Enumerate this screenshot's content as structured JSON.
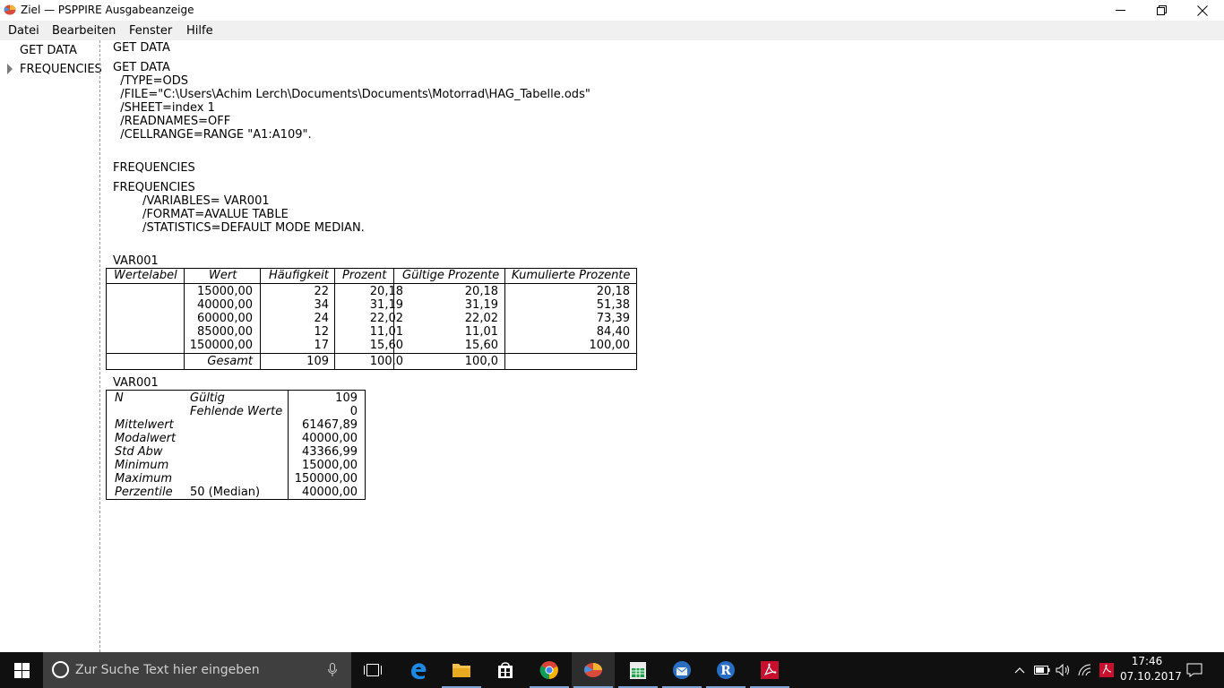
{
  "window": {
    "title": "Ziel — PSPPIRE Ausgabeanzeige"
  },
  "menu": [
    "Datei",
    "Bearbeiten",
    "Fenster",
    "Hilfe"
  ],
  "sidebar": {
    "items": [
      {
        "label": "GET DATA"
      },
      {
        "label": "FREQUENCIES"
      }
    ]
  },
  "content": {
    "get_data_heading": "GET DATA",
    "get_data_syntax": [
      "GET DATA",
      "  /TYPE=ODS",
      "  /FILE=\"C:\\Users\\Achim Lerch\\Documents\\Documents\\Motorrad\\HAG_Tabelle.ods\"",
      "  /SHEET=index 1",
      "  /READNAMES=OFF",
      "  /CELLRANGE=RANGE \"A1:A109\"."
    ],
    "frequencies_heading": "FREQUENCIES",
    "frequencies_syntax": [
      "FREQUENCIES",
      "        /VARIABLES= VAR001",
      "        /FORMAT=AVALUE TABLE",
      "        /STATISTICS=DEFAULT MODE MEDIAN."
    ],
    "freq_table": {
      "caption": "VAR001",
      "headers": [
        "Wertelabel",
        "Wert",
        "Häufigkeit",
        "Prozent",
        "Gültige Prozente",
        "Kumulierte Prozente"
      ],
      "rows": [
        [
          "",
          "15000,00",
          "22",
          "20,18",
          "20,18",
          "20,18"
        ],
        [
          "",
          "40000,00",
          "34",
          "31,19",
          "31,19",
          "51,38"
        ],
        [
          "",
          "60000,00",
          "24",
          "22,02",
          "22,02",
          "73,39"
        ],
        [
          "",
          "85000,00",
          "12",
          "11,01",
          "11,01",
          "84,40"
        ],
        [
          "",
          "150000,00",
          "17",
          "15,60",
          "15,60",
          "100,00"
        ]
      ],
      "total": [
        "Gesamt",
        "109",
        "100,0",
        "100,0",
        ""
      ]
    },
    "stats_table": {
      "caption": "VAR001",
      "rows": [
        [
          "N",
          "Gültig",
          "109"
        ],
        [
          "",
          "Fehlende Werte",
          "0"
        ],
        [
          "Mittelwert",
          "",
          "61467,89"
        ],
        [
          "Modalwert",
          "",
          "40000,00"
        ],
        [
          "Std Abw",
          "",
          "43366,99"
        ],
        [
          "Minimum",
          "",
          "15000,00"
        ],
        [
          "Maximum",
          "",
          "150000,00"
        ],
        [
          "Perzentile",
          "50 (Median)",
          "40000,00"
        ]
      ]
    }
  },
  "taskbar": {
    "search_placeholder": "Zur Suche Text hier eingeben",
    "apps": [
      "task-view",
      "edge",
      "file-explorer",
      "store",
      "chrome",
      "pspp",
      "calc",
      "thunderbird",
      "r",
      "acrobat"
    ],
    "clock": {
      "time": "17:46",
      "date": "07.10.2017"
    }
  },
  "colors": {
    "menubar_bg": "#f0f0f0",
    "taskbar_bg": "#101010",
    "search_bg": "#3f3f3f",
    "accent": "#7da6d6"
  }
}
